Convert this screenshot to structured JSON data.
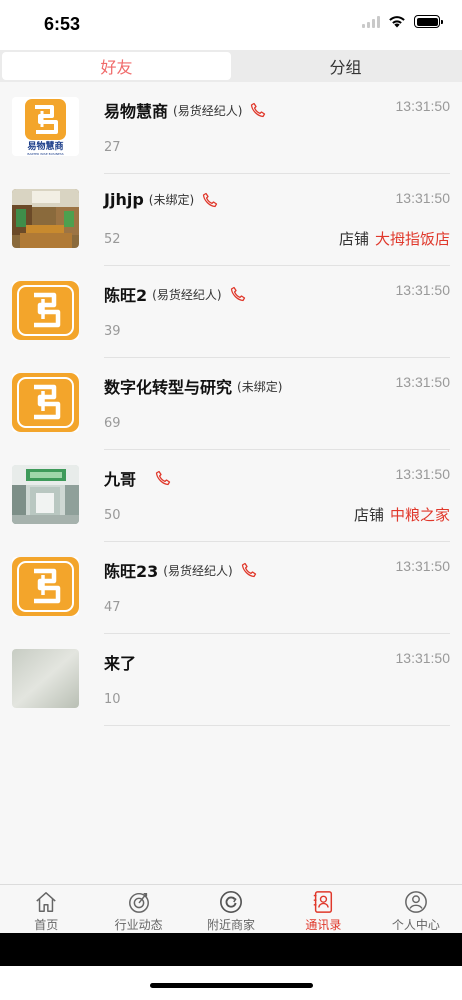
{
  "status_bar": {
    "time": "6:53"
  },
  "segments": {
    "friends": "好友",
    "groups": "分组"
  },
  "contacts": [
    {
      "name": "易物慧商",
      "role": "(易货经纪人)",
      "time": "13:31:50",
      "count": "27",
      "has_phone": true,
      "avatar": "yiwu-logo",
      "logo_text": "易物慧商",
      "logo_sub": "BARTER WISE BUSINESS"
    },
    {
      "name": "Jjhjp",
      "role": "(未绑定)",
      "time": "13:31:50",
      "count": "52",
      "has_phone": true,
      "avatar": "photo-store",
      "shop_label": "店铺",
      "shop_name": "大拇指饭店"
    },
    {
      "name": "陈旺2",
      "role": "(易货经纪人)",
      "time": "13:31:50",
      "count": "39",
      "has_phone": true,
      "avatar": "app-logo"
    },
    {
      "name": "数字化转型与研究",
      "role": "(未绑定)",
      "time": "13:31:50",
      "count": "69",
      "has_phone": false,
      "avatar": "app-logo"
    },
    {
      "name": "九哥",
      "role": "",
      "time": "13:31:50",
      "count": "50",
      "has_phone": true,
      "avatar": "photo-shopfront",
      "shop_label": "店铺",
      "shop_name": "中粮之家"
    },
    {
      "name": "陈旺23",
      "role": "(易货经纪人)",
      "time": "13:31:50",
      "count": "47",
      "has_phone": true,
      "avatar": "app-logo"
    },
    {
      "name": "来了",
      "role": "",
      "time": "13:31:50",
      "count": "10",
      "has_phone": false,
      "avatar": "photo-blur"
    }
  ],
  "tabbar": [
    {
      "label": "首页",
      "icon": "home-icon",
      "active": false
    },
    {
      "label": "行业动态",
      "icon": "industry-news-icon",
      "active": false
    },
    {
      "label": "附近商家",
      "icon": "nearby-merchants-icon",
      "active": false
    },
    {
      "label": "通讯录",
      "icon": "contacts-icon",
      "active": true
    },
    {
      "label": "个人中心",
      "icon": "profile-icon",
      "active": false
    }
  ],
  "colors": {
    "accent": "#e0382b",
    "segment_active": "#f06a6a",
    "logo_orange": "#f3a52b"
  }
}
